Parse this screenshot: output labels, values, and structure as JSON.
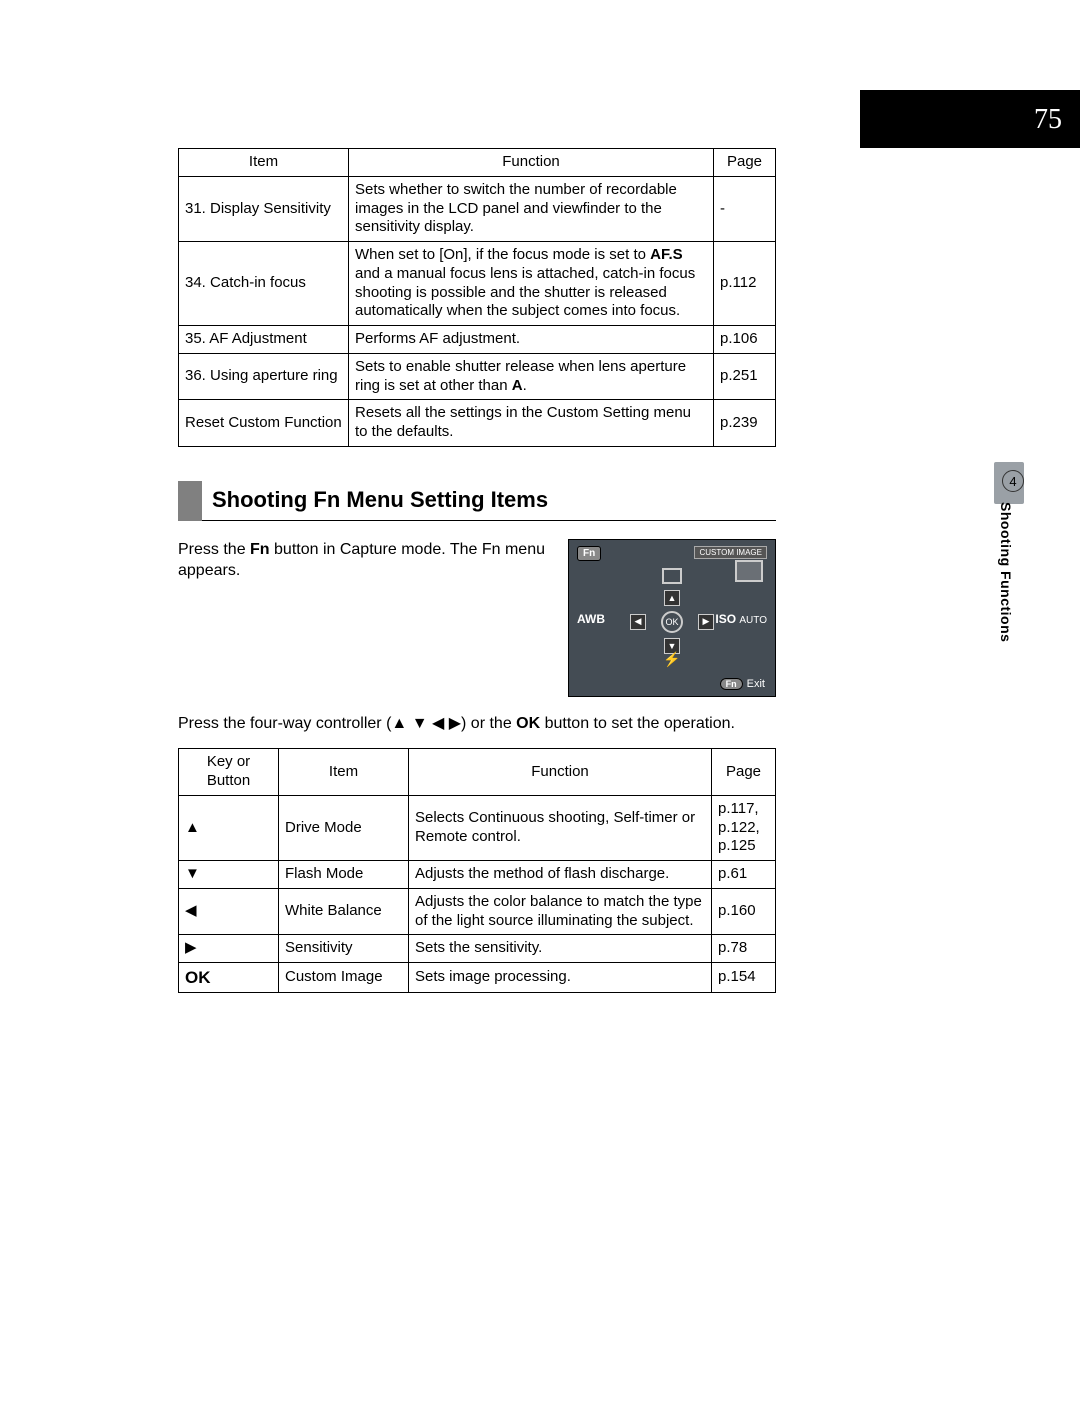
{
  "page_number": "75",
  "side_tab": {
    "chapter": "4",
    "label": "Shooting Functions"
  },
  "table1": {
    "headers": {
      "item": "Item",
      "function": "Function",
      "page": "Page"
    },
    "rows": [
      {
        "item": "31. Display Sensitivity",
        "function": "Sets whether to switch the number of recordable images in the LCD panel and viewfinder to the sensitivity display.",
        "page": "-"
      },
      {
        "item": "34. Catch-in focus",
        "function_pre": "When set to [On], if the focus mode is set to ",
        "function_bold": "AF.S",
        "function_post": " and a manual focus lens is attached, catch-in focus shooting is possible and the shutter is released automatically when the subject comes into focus.",
        "page": "p.112"
      },
      {
        "item": "35. AF Adjustment",
        "function": "Performs AF adjustment.",
        "page": "p.106"
      },
      {
        "item": "36. Using aperture ring",
        "function_pre": "Sets to enable shutter release when lens aperture ring is set at other than ",
        "function_bold": "A",
        "function_post": ".",
        "page": "p.251"
      },
      {
        "item": "Reset Custom Function",
        "function": "Resets all the settings in the Custom Setting menu to the defaults.",
        "page": "p.239"
      }
    ]
  },
  "heading": "Shooting Fn Menu Setting Items",
  "intro": {
    "pre": "Press the ",
    "bold": "Fn",
    "post": " button in Capture mode. The Fn menu appears."
  },
  "fn_screen": {
    "fn": "Fn",
    "custom": "CUSTOM IMAGE",
    "ok": "OK",
    "awb": "AWB",
    "iso": "ISO",
    "iso_auto": "AUTO",
    "exit_fn": "Fn",
    "exit": "Exit",
    "flash": "⯮"
  },
  "mid": {
    "line1_pre": "Press the four-way controller (",
    "line1_arrows": "▲ ▼ ◀ ▶",
    "line1_post": ") or the ",
    "line1_ok": "OK",
    "line1_end": " button to set the operation."
  },
  "table2": {
    "headers": {
      "key": "Key or Button",
      "item": "Item",
      "function": "Function",
      "page": "Page"
    },
    "rows": [
      {
        "key": "▲",
        "item": "Drive Mode",
        "function": "Selects Continuous shooting, Self-timer or Remote control.",
        "page": "p.117, p.122, p.125"
      },
      {
        "key": "▼",
        "item": "Flash Mode",
        "function": "Adjusts the method of flash discharge.",
        "page": "p.61"
      },
      {
        "key": "◀",
        "item": "White Balance",
        "function": "Adjusts the color balance to match the type of the light source illuminating the subject.",
        "page": "p.160"
      },
      {
        "key": "▶",
        "item": "Sensitivity",
        "function": "Sets the sensitivity.",
        "page": "p.78"
      },
      {
        "key": "OK",
        "item": "Custom Image",
        "function": "Sets image processing.",
        "page": "p.154"
      }
    ]
  }
}
